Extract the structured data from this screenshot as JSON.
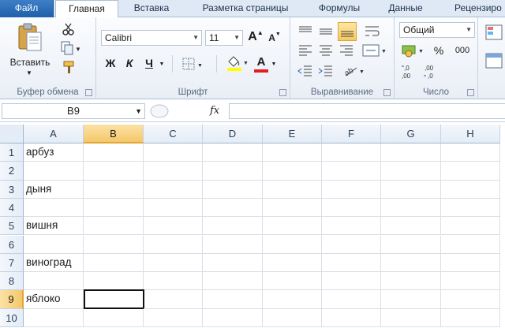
{
  "tabs": [
    "Файл",
    "Главная",
    "Вставка",
    "Разметка страницы",
    "Формулы",
    "Данные",
    "Рецензиро"
  ],
  "active_tab": "Главная",
  "clipboard": {
    "paste_label": "Вставить",
    "group_label": "Буфер обмена"
  },
  "font": {
    "name": "Calibri",
    "size": "11",
    "bold": "Ж",
    "italic": "К",
    "underline": "Ч",
    "grow": "A",
    "shrink": "A",
    "font_color_glyph": "A",
    "group_label": "Шрифт",
    "highlight_color": "#ffff00",
    "font_color": "#e02020"
  },
  "alignment": {
    "group_label": "Выравнивание"
  },
  "number": {
    "format": "Общий",
    "percent": "%",
    "thousands": "000",
    "inc_decimal": ",0\n,00",
    "group_label": "Число"
  },
  "formula_bar": {
    "name_box": "B9",
    "fx": "fx",
    "value": ""
  },
  "columns": [
    "A",
    "B",
    "C",
    "D",
    "E",
    "F",
    "G",
    "H"
  ],
  "selected_column": "B",
  "rows": [
    "1",
    "2",
    "3",
    "4",
    "5",
    "6",
    "7",
    "8",
    "9",
    "10"
  ],
  "selected_row": "9",
  "cells_a": [
    "арбуз",
    "",
    "дыня",
    "",
    "вишня",
    "",
    "виноград",
    "",
    "яблоко",
    ""
  ],
  "active_cell": "B9"
}
